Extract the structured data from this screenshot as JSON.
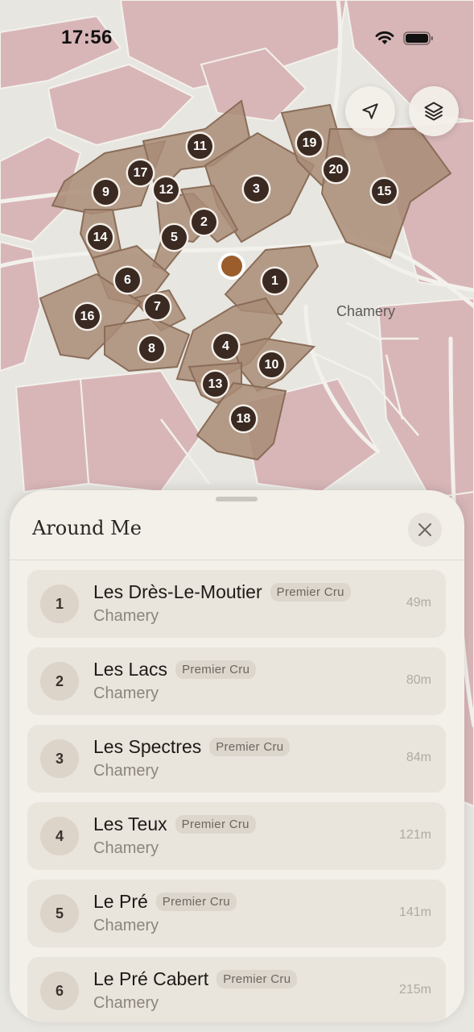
{
  "status_bar": {
    "time": "17:56"
  },
  "map": {
    "town_label": "Chamery",
    "markers": [
      "1",
      "2",
      "3",
      "4",
      "5",
      "6",
      "7",
      "8",
      "9",
      "10",
      "11",
      "12",
      "13",
      "14",
      "15",
      "16",
      "17",
      "18",
      "19",
      "20"
    ],
    "colors": {
      "parcel": "#a98c77",
      "vineyard": "#d8b6b8",
      "land": "#e7e6e1",
      "road": "#f3f1ec"
    }
  },
  "map_controls": {
    "locate_icon": "location-arrow-icon",
    "layers_icon": "layers-icon"
  },
  "sheet": {
    "title": "Around Me",
    "close_icon": "close-icon",
    "items": [
      {
        "rank": "1",
        "name": "Les Drès-Le-Moutier",
        "badge": "Premier Cru",
        "town": "Chamery",
        "distance": "49m"
      },
      {
        "rank": "2",
        "name": "Les Lacs",
        "badge": "Premier Cru",
        "town": "Chamery",
        "distance": "80m"
      },
      {
        "rank": "3",
        "name": "Les Spectres",
        "badge": "Premier Cru",
        "town": "Chamery",
        "distance": "84m"
      },
      {
        "rank": "4",
        "name": "Les Teux",
        "badge": "Premier Cru",
        "town": "Chamery",
        "distance": "121m"
      },
      {
        "rank": "5",
        "name": "Le Pré",
        "badge": "Premier Cru",
        "town": "Chamery",
        "distance": "141m"
      },
      {
        "rank": "6",
        "name": "Le Pré Cabert",
        "badge": "Premier Cru",
        "town": "Chamery",
        "distance": "215m"
      }
    ]
  }
}
